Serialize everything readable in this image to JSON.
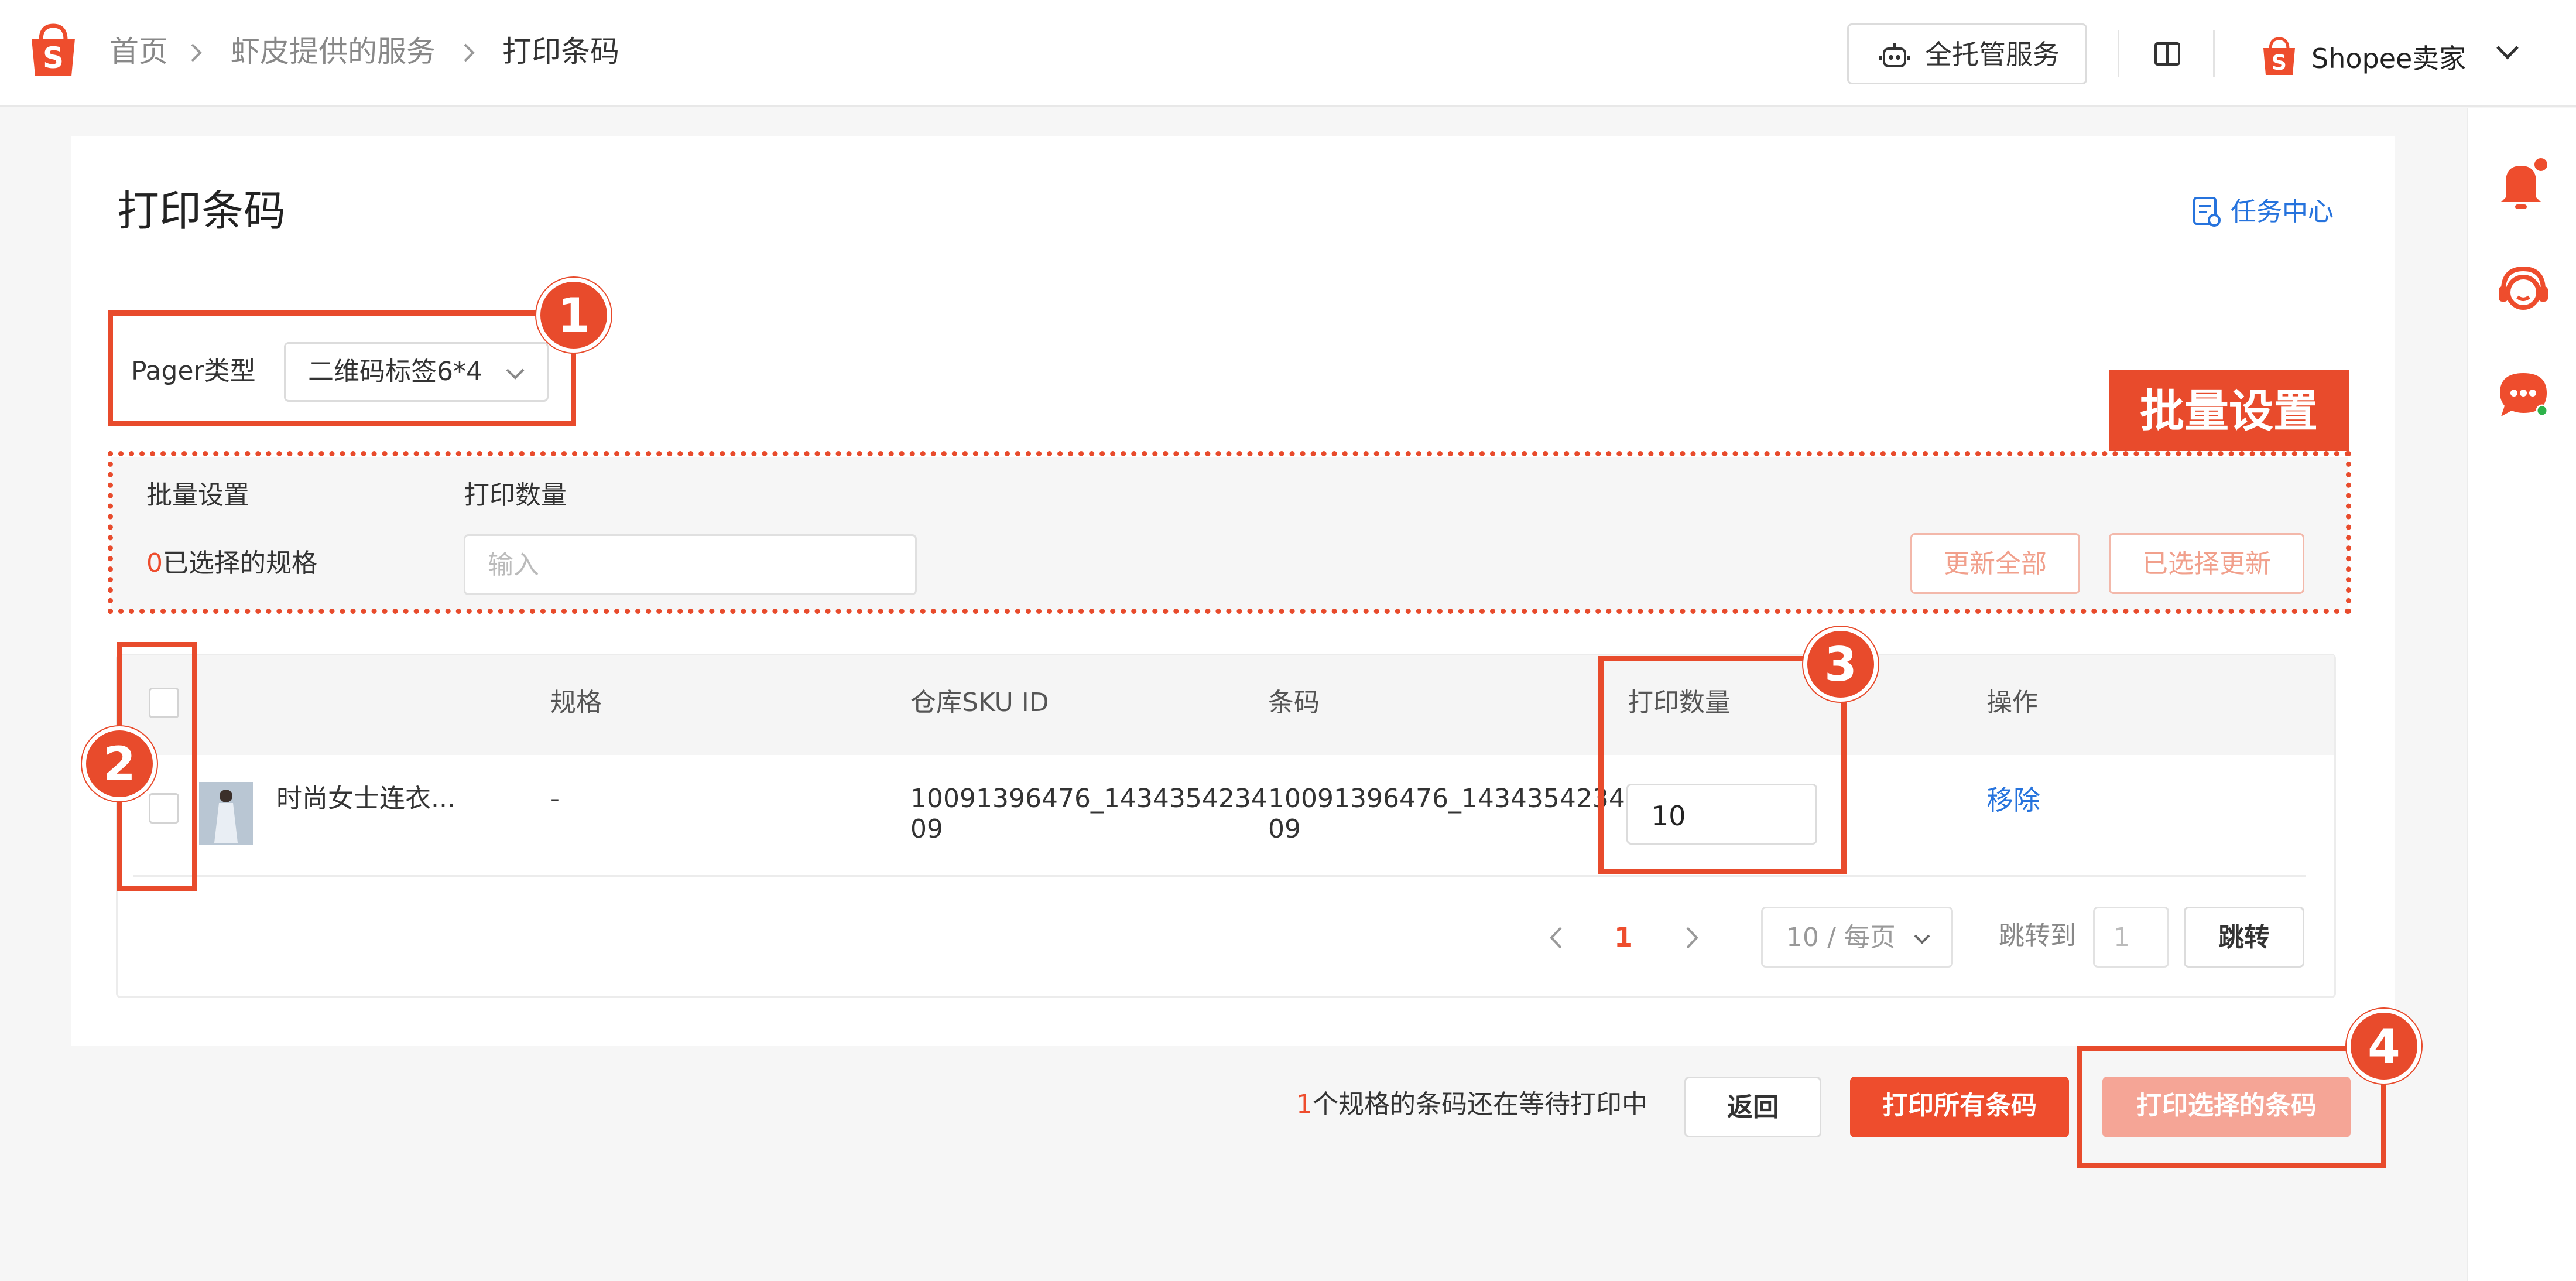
{
  "header": {
    "breadcrumb": [
      "首页",
      "虾皮提供的服务",
      "打印条码"
    ],
    "managed_service_label": "全托管服务",
    "seller_name": "Shopee卖家",
    "logo_letter": "S",
    "brand_color": "#ee4d2d"
  },
  "page": {
    "title": "打印条码",
    "task_center_label": "任务中心"
  },
  "pager": {
    "label": "Pager类型",
    "selected": "二维码标签6*4"
  },
  "batch": {
    "title": "批量设置",
    "qty_header": "打印数量",
    "selected_count": "0",
    "selected_suffix": "已选择的规格",
    "qty_placeholder": "输入",
    "update_all_label": "更新全部",
    "update_selected_label": "已选择更新"
  },
  "table": {
    "columns": [
      "规格",
      "仓库SKU ID",
      "条码",
      "打印数量",
      "操作"
    ],
    "rows": [
      {
        "product": "时尚女士连衣...",
        "spec": "-",
        "sku_line1": "10091396476_1434354234",
        "sku_line2": "09",
        "barcode_line1": "10091396476_1434354234",
        "barcode_line2": "09",
        "qty": "10",
        "action": "移除"
      }
    ]
  },
  "pagination": {
    "current_page": "1",
    "page_size_label": "10 / 每页",
    "jump_label": "跳转到",
    "jump_value": "1",
    "jump_button": "跳转"
  },
  "footer": {
    "pending_count": "1",
    "pending_suffix": "个规格的条码还在等待打印中",
    "back_label": "返回",
    "print_all_label": "打印所有条码",
    "print_selected_label": "打印选择的条码"
  },
  "annotations": {
    "numbers": [
      "1",
      "2",
      "3",
      "4"
    ],
    "batch_tag": "批量设置",
    "color": "#e84b2c"
  }
}
